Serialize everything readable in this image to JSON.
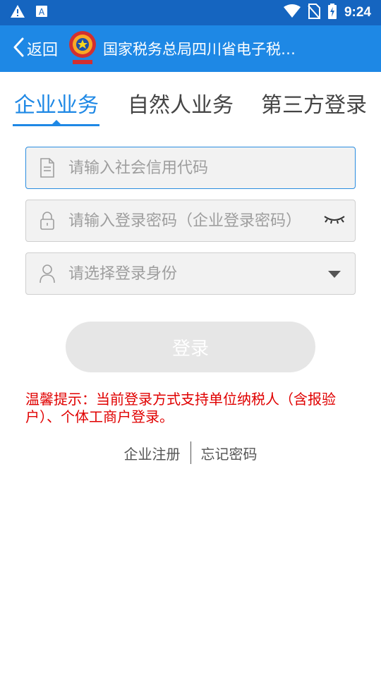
{
  "status_bar": {
    "time": "9:24",
    "icons": [
      "warning-icon",
      "app-notification-icon",
      "wifi-icon",
      "no-sim-icon",
      "battery-charging-icon"
    ]
  },
  "app_bar": {
    "back_label": "返回",
    "title": "国家税务总局四川省电子税…",
    "emblem": "tax-emblem-icon"
  },
  "tabs": [
    {
      "label": "企业业务",
      "active": true
    },
    {
      "label": "自然人业务",
      "active": false
    },
    {
      "label": "第三方登录",
      "active": false
    }
  ],
  "form": {
    "credit_code_placeholder": "请输入社会信用代码",
    "password_placeholder": "请输入登录密码（企业登录密码）",
    "identity_placeholder": "请选择登录身份"
  },
  "login_button": "登录",
  "tip": "温馨提示：当前登录方式支持单位纳税人（含报验户）、个体工商户登录。",
  "links": {
    "register": "企业注册",
    "forgot": "忘记密码"
  },
  "colors": {
    "status_bar": "#1565c0",
    "app_bar": "#1e88e5",
    "accent": "#1e88e5",
    "tip": "#e00000",
    "button_disabled": "#e6e6e6"
  }
}
